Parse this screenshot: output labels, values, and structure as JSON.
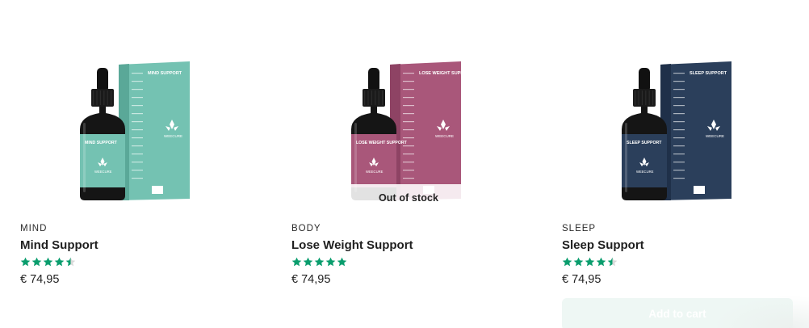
{
  "products": [
    {
      "category": "MIND",
      "name": "Mind Support",
      "price": "€ 74,95",
      "rating": 4.5,
      "rating_text": "4.5 of 5 stars",
      "box_color": "#74c2b2",
      "box_color_dark": "#5aa898",
      "box_title": "MIND SUPPORT",
      "bottle_label": "MIND SUPPORT",
      "brand": "WEECURE"
    },
    {
      "category": "BODY",
      "name": "Lose Weight Support",
      "price": "€ 74,95",
      "rating": 5,
      "rating_text": "5 of 5 stars",
      "box_color": "#a9577a",
      "box_color_dark": "#8e4364",
      "box_title": "LOSE WEIGHT SUPPORT",
      "bottle_label": "LOSE WEIGHT SUPPORT",
      "brand": "WEECURE",
      "badge": "Out of stock"
    },
    {
      "category": "SLEEP",
      "name": "Sleep Support",
      "price": "€ 74,95",
      "rating": 4.5,
      "rating_text": "4.5 of 5 stars",
      "box_color": "#2b3f5b",
      "box_color_dark": "#1f3049",
      "box_title": "SLEEP SUPPORT",
      "bottle_label": "SLEEP SUPPORT",
      "brand": "WEECURE",
      "button": "Add to cart"
    }
  ],
  "star_color": "#0a9d6d"
}
